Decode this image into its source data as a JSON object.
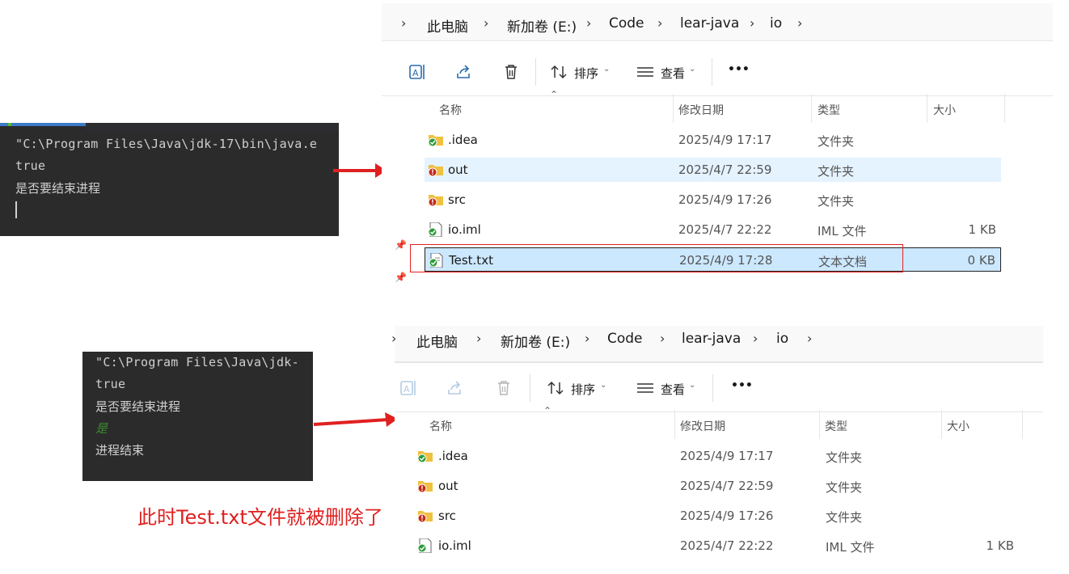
{
  "consoles": [
    {
      "lines": [
        "\"C:\\Program Files\\Java\\jdk-17\\bin\\java.e",
        "true",
        "是否要结束进程"
      ]
    },
    {
      "lines": [
        "\"C:\\Program Files\\Java\\jdk-",
        "true",
        "是否要结束进程",
        "是",
        "进程结束"
      ]
    }
  ],
  "breadcrumb": [
    "此电脑",
    "新加卷 (E:)",
    "Code",
    "lear-java",
    "io"
  ],
  "toolbar": {
    "sort_label": "排序",
    "view_label": "查看",
    "more_label": "•••"
  },
  "columns": {
    "name": "名称",
    "date": "修改日期",
    "type": "类型",
    "size": "大小"
  },
  "before": {
    "rows": [
      {
        "name": ".idea",
        "date": "2025/4/9 17:17",
        "type": "文件夹",
        "size": "",
        "icon": "folder-synced-icon"
      },
      {
        "name": "out",
        "date": "2025/4/7 22:59",
        "type": "文件夹",
        "size": "",
        "icon": "folder-sync-error-icon"
      },
      {
        "name": "src",
        "date": "2025/4/9 17:26",
        "type": "文件夹",
        "size": "",
        "icon": "folder-sync-error-icon"
      },
      {
        "name": "io.iml",
        "date": "2025/4/7 22:22",
        "type": "IML 文件",
        "size": "1 KB",
        "icon": "file-synced-icon"
      },
      {
        "name": "Test.txt",
        "date": "2025/4/9 17:28",
        "type": "文本文档",
        "size": "0 KB",
        "icon": "text-file-synced-icon"
      }
    ]
  },
  "after": {
    "rows": [
      {
        "name": ".idea",
        "date": "2025/4/9 17:17",
        "type": "文件夹",
        "size": "",
        "icon": "folder-synced-icon"
      },
      {
        "name": "out",
        "date": "2025/4/7 22:59",
        "type": "文件夹",
        "size": "",
        "icon": "folder-sync-error-icon"
      },
      {
        "name": "src",
        "date": "2025/4/9 17:26",
        "type": "文件夹",
        "size": "",
        "icon": "folder-sync-error-icon"
      },
      {
        "name": "io.iml",
        "date": "2025/4/7 22:22",
        "type": "IML 文件",
        "size": "1 KB",
        "icon": "file-synced-icon"
      }
    ]
  },
  "annotation": "此时Test.txt文件就被删除了",
  "colors": {
    "accent": "#e02020",
    "console_bg": "#2b2b2b",
    "selection": "#cce8ff",
    "hover": "#e5f3ff"
  }
}
